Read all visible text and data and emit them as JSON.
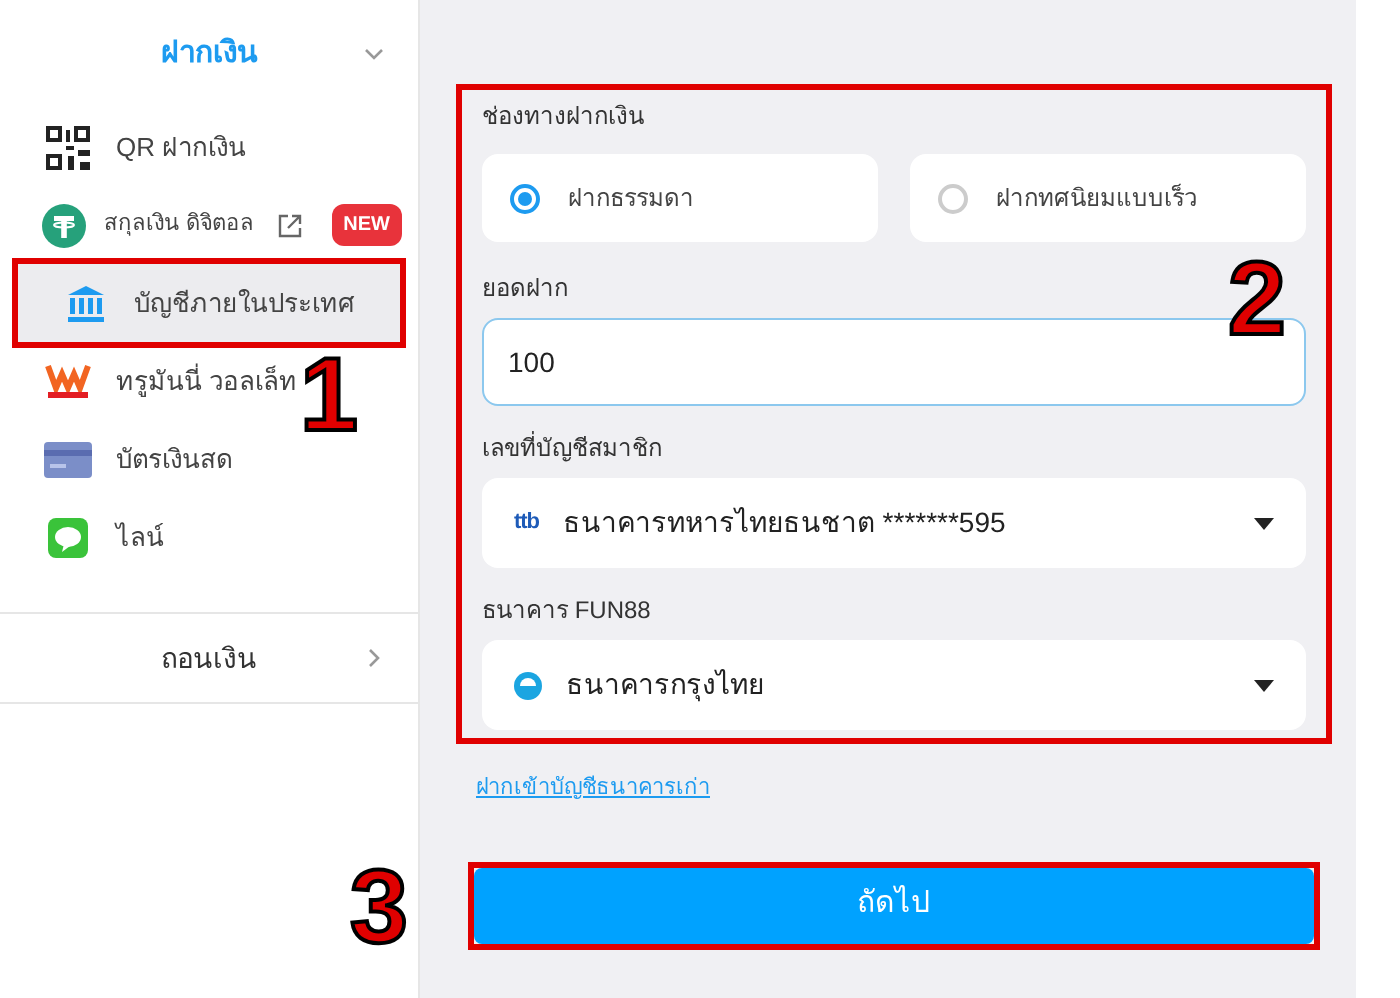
{
  "sidebar": {
    "deposit_header": {
      "label": "ฝากเงิน",
      "expanded": true
    },
    "items": [
      {
        "kind": "qr",
        "label": "QR ฝากเงิน",
        "selected": false,
        "highlighted": false
      },
      {
        "kind": "tether",
        "label": "สกุลเงิน ดิจิตอล",
        "external": true,
        "badge": "NEW",
        "selected": false,
        "highlighted": false
      },
      {
        "kind": "bank",
        "label": "บัญชีภายในประเทศ",
        "selected": true,
        "highlighted": true
      },
      {
        "kind": "wallet",
        "label": "ทรูมันนี่ วอลเล็ท",
        "selected": false,
        "highlighted": false
      },
      {
        "kind": "card",
        "label": "บัตรเงินสด",
        "selected": false,
        "highlighted": false
      },
      {
        "kind": "chat",
        "label": "ไลน์",
        "selected": false,
        "highlighted": false
      }
    ],
    "withdraw_header": {
      "label": "ถอนเงิน",
      "expanded": false
    }
  },
  "form": {
    "highlighted": true,
    "method_label": "ช่องทางฝากเงิน",
    "methods": [
      {
        "label": "ฝากธรรมดา",
        "selected": true
      },
      {
        "label": "ฝากทศนิยมแบบเร็ว",
        "selected": false
      }
    ],
    "amount_label": "ยอดฝาก",
    "amount_value": "100",
    "member_account_label": "เลขที่บัญชีสมาชิก",
    "member_account": {
      "logo": "ttb",
      "value": "ธนาคารทหารไทยธนชาต *******595"
    },
    "fun88_bank_label": "ธนาคาร FUN88",
    "fun88_bank": {
      "value": "ธนาคารกรุงไทย"
    }
  },
  "old_account_link": "ฝากเข้าบัญชีธนาคารเก่า",
  "next_button": {
    "label": "ถัดไป",
    "highlighted": true
  },
  "annotations": [
    {
      "label": "1"
    },
    {
      "label": "2"
    },
    {
      "label": "3"
    }
  ]
}
